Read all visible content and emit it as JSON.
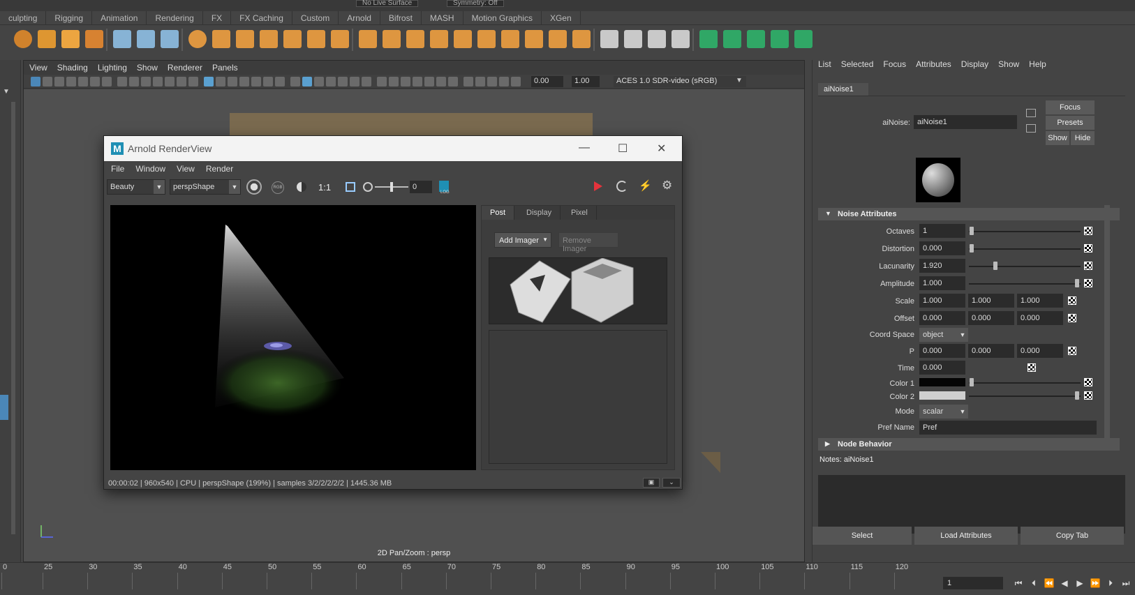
{
  "shelf_tabs": [
    "culpting",
    "Rigging",
    "Animation",
    "Rendering",
    "FX",
    "FX Caching",
    "Custom",
    "Arnold",
    "Bifrost",
    "MASH",
    "Motion Graphics",
    "XGen"
  ],
  "top_strip": {
    "live_surface": "No Live Surface",
    "symmetry": "Symmetry: Off"
  },
  "shelf_icons": [
    "polygon-icon",
    "star-icon",
    "text-icon",
    "svg-icon",
    "snap-icon",
    "transform-icon",
    "particle-icon",
    "sphere-icon",
    "cubes-icon",
    "boolean-icon",
    "grid-icon",
    "mirror-icon",
    "combine-icon",
    "extrude-icon",
    "bevel-icon",
    "bridge-icon",
    "poke-icon",
    "wedge-icon",
    "bridge2-icon",
    "slice-icon",
    "target-weld-icon",
    "quad-draw-icon",
    "uv-icon",
    "cut-icon",
    "multicut-icon",
    "uv-editor-icon",
    "unfold-icon",
    "layout-icon",
    "sew-icon",
    "cut-uv-icon",
    "checker-icon",
    "distort-icon",
    "straighten-icon"
  ],
  "viewport": {
    "menu": [
      "View",
      "Shading",
      "Lighting",
      "Show",
      "Renderer",
      "Panels"
    ],
    "exposure": "0.00",
    "gamma": "1.00",
    "color_space": "ACES 1.0 SDR-video (sRGB)",
    "status": "2D Pan/Zoom : persp"
  },
  "arnold": {
    "title": "Arnold RenderView",
    "logo": "M",
    "menu": [
      "File",
      "Window",
      "View",
      "Render"
    ],
    "aov": "Beauty",
    "camera": "perspShape",
    "ratio": "1:1",
    "exposure": "0",
    "rgb": "RGB",
    "log": "LOG",
    "side_tabs": [
      "Post",
      "Display",
      "Pixel"
    ],
    "add_imager": "Add Imager",
    "remove_imager": "Remove Imager",
    "status": "00:00:02 | 960x540 | CPU | perspShape (199%) | samples 3/2/2/2/2/2 | 1445.36 MB"
  },
  "attr": {
    "menu": [
      "List",
      "Selected",
      "Focus",
      "Attributes",
      "Display",
      "Show",
      "Help"
    ],
    "tab": "aiNoise1",
    "node_label": "aiNoise:",
    "node_name": "aiNoise1",
    "focus": "Focus",
    "presets": "Presets",
    "show": "Show",
    "hide": "Hide",
    "section_noise": "Noise Attributes",
    "octaves_label": "Octaves",
    "octaves": "1",
    "distortion_label": "Distortion",
    "distortion": "0.000",
    "lacunarity_label": "Lacunarity",
    "lacunarity": "1.920",
    "amplitude_label": "Amplitude",
    "amplitude": "1.000",
    "scale_label": "Scale",
    "scale": [
      "1.000",
      "1.000",
      "1.000"
    ],
    "offset_label": "Offset",
    "offset": [
      "0.000",
      "0.000",
      "0.000"
    ],
    "coord_label": "Coord Space",
    "coord": "object",
    "p_label": "P",
    "p": [
      "0.000",
      "0.000",
      "0.000"
    ],
    "time_label": "Time",
    "time": "0.000",
    "color1_label": "Color 1",
    "color1": "#050505",
    "color2_label": "Color 2",
    "color2": "#cfcfcf",
    "mode_label": "Mode",
    "mode": "scalar",
    "pref_label": "Pref Name",
    "pref": "Pref",
    "section_behavior": "Node Behavior",
    "notes": "Notes:  aiNoise1",
    "select": "Select",
    "load": "Load Attributes",
    "copy": "Copy Tab"
  },
  "timeline": {
    "ticks": [
      "0",
      "25",
      "30",
      "35",
      "40",
      "45",
      "50",
      "55",
      "60",
      "65",
      "70",
      "75",
      "80",
      "85",
      "90",
      "95",
      "100",
      "105",
      "110",
      "115",
      "120"
    ],
    "current_frame": "1",
    "controls": [
      "⏮",
      "⏴",
      "⏪",
      "◀",
      "▶",
      "⏩",
      "⏵",
      "⏭"
    ]
  }
}
